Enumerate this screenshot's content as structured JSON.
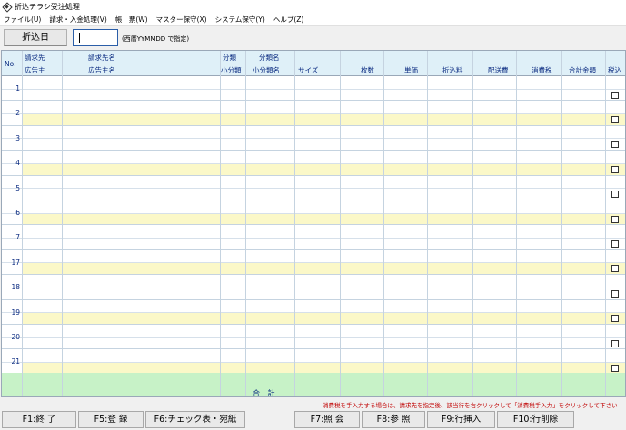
{
  "window": {
    "title": "折込チラシ受注処理"
  },
  "menu": [
    "ファイル(U)",
    "請求・入金処理(V)",
    "帳　票(W)",
    "マスター保守(X)",
    "システム保守(Y)",
    "ヘルプ(Z)"
  ],
  "date_entry": {
    "label": "折込日",
    "value": "",
    "hint": "(西暦YYMMDD で指定)"
  },
  "table": {
    "headers": {
      "no": "No.",
      "billing_code": "請求先",
      "advertiser_code": "広告主",
      "billing_name": "請求先名",
      "advertiser_name": "広告主名",
      "category": "分類",
      "subcategory": "小分類",
      "category_name": "分類名",
      "subcategory_name": "小分類名",
      "size": "サイズ",
      "quantity": "枚数",
      "unit_price": "単価",
      "folding_fee": "折込料",
      "delivery_fee": "配送費",
      "consumption_tax": "消費税",
      "total_amount": "合計金額",
      "tax_included": "税込"
    },
    "row_numbers": [
      "1",
      "2",
      "3",
      "4",
      "5",
      "6",
      "7",
      "17",
      "18",
      "19",
      "20",
      "21"
    ],
    "total_label": "合 計"
  },
  "colors": {
    "header_bg": "#dff0f8",
    "row_alt": "#fbf8c8",
    "total_bg": "#c7f2c7",
    "notice": "#c00000"
  },
  "notice": "消費税を手入力する場合は、請求先を指定後、該当行を右クリックして「消費税手入力」をクリックして下さい",
  "function_keys": [
    "F1:終 了",
    "F5:登 録",
    "F6:チェック表・宛紙",
    "F7:照 会",
    "F8:参 照",
    "F9:行挿入",
    "F10:行削除"
  ]
}
